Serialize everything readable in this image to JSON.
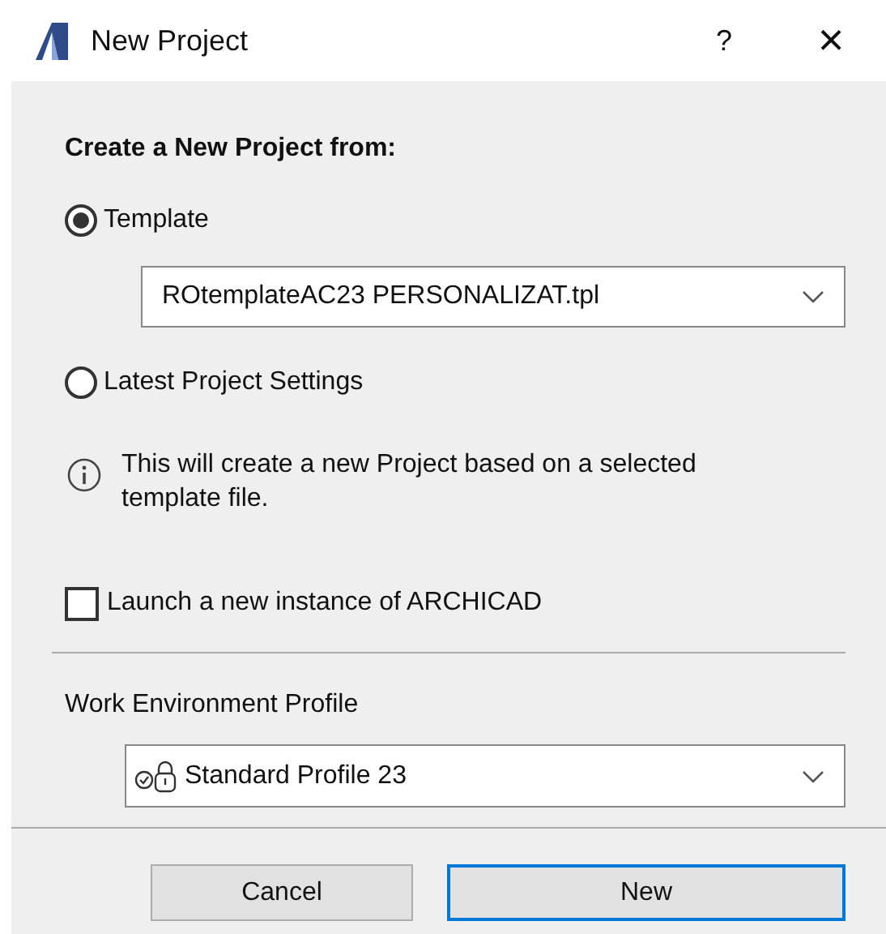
{
  "window": {
    "title": "New Project",
    "help": "?",
    "close": "×"
  },
  "heading": "Create a New Project from:",
  "sources": [
    {
      "label": "Template",
      "selected": true
    },
    {
      "label": "Latest Project Settings",
      "selected": false
    }
  ],
  "template_select": {
    "value": "ROtemplateAC23 PERSONALIZAT.tpl"
  },
  "info": "This will create a new Project based on a selected template file.",
  "launch_checkbox": {
    "label": "Launch a new instance of ARCHICAD",
    "checked": false
  },
  "profile": {
    "label": "Work Environment Profile",
    "value": "Standard Profile 23"
  },
  "buttons": [
    {
      "label": "Cancel",
      "default": false
    },
    {
      "label": "New",
      "default": true
    }
  ]
}
